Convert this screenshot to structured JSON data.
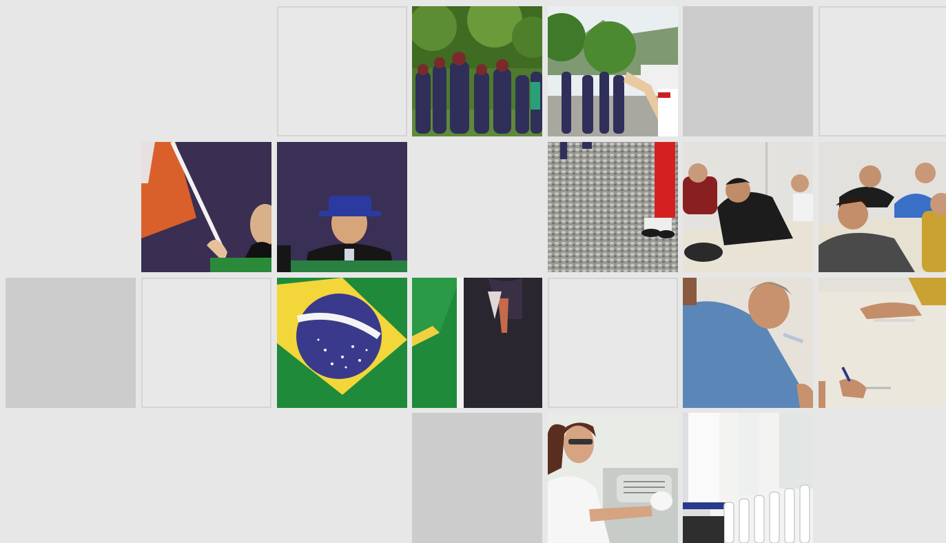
{
  "mosaic": {
    "tiles": [
      {
        "id": "r0c2",
        "kind": "outline"
      },
      {
        "id": "r0c3",
        "kind": "photo",
        "subject": "dancers-forest"
      },
      {
        "id": "r0c4",
        "kind": "photo",
        "subject": "dancers-road"
      },
      {
        "id": "r0c5",
        "kind": "solid"
      },
      {
        "id": "r0c6",
        "kind": "outline"
      },
      {
        "id": "r1c1",
        "kind": "photo",
        "subject": "flag-bearer"
      },
      {
        "id": "r1c2",
        "kind": "photo",
        "subject": "man-blue-hat"
      },
      {
        "id": "r1c4",
        "kind": "photo",
        "subject": "gravel-feet"
      },
      {
        "id": "r1c5",
        "kind": "photo",
        "subject": "students-exam"
      },
      {
        "id": "r1c6",
        "kind": "photo",
        "subject": "students-exam"
      },
      {
        "id": "r2c0",
        "kind": "solid"
      },
      {
        "id": "r2c1",
        "kind": "outline"
      },
      {
        "id": "r2c2",
        "kind": "photo",
        "subject": "brazil-flag"
      },
      {
        "id": "r2c3",
        "kind": "photo",
        "subject": "green-flag-suit"
      },
      {
        "id": "r2c4",
        "kind": "outline"
      },
      {
        "id": "r2c5",
        "kind": "photo",
        "subject": "man-writing"
      },
      {
        "id": "r2c6",
        "kind": "photo",
        "subject": "hands-writing"
      },
      {
        "id": "r3c3",
        "kind": "solid"
      },
      {
        "id": "r3c4",
        "kind": "photo",
        "subject": "lab-technician"
      },
      {
        "id": "r3c5",
        "kind": "photo",
        "subject": "lab-equipment"
      }
    ],
    "colors": {
      "background": "#e7e7e7",
      "outline_border": "#d4d4d4",
      "solid_fill": "#cccccc"
    }
  }
}
